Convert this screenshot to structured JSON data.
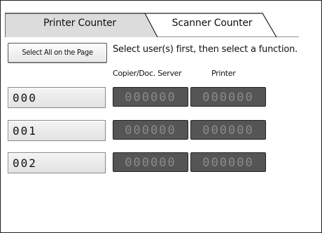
{
  "tabs": [
    {
      "label": "Printer Counter",
      "active": true
    },
    {
      "label": "Scanner Counter",
      "active": false
    }
  ],
  "toolbar": {
    "select_all_label": "Select All on the Page",
    "instruction": "Select user(s) first, then select a function."
  },
  "columns": {
    "copier": "Copier/Doc. Server",
    "printer": "Printer"
  },
  "users": [
    {
      "id": "000",
      "copier": "000000",
      "printer": "000000"
    },
    {
      "id": "001",
      "copier": "000000",
      "printer": "000000"
    },
    {
      "id": "002",
      "copier": "000000",
      "printer": "000000"
    }
  ],
  "colors": {
    "counter_bg": "#555555",
    "counter_text": "#8a8a8a"
  }
}
